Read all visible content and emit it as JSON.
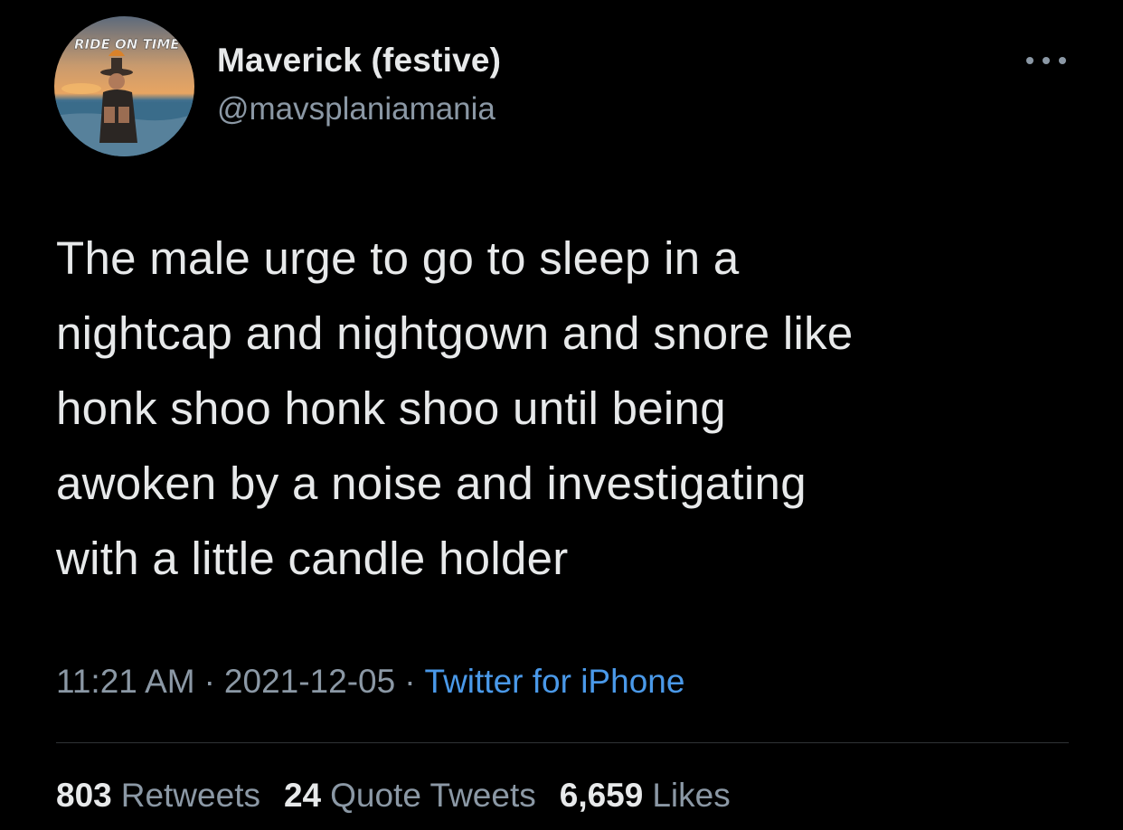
{
  "user": {
    "display_name": "Maverick (festive)",
    "handle": "@mavsplaniamania",
    "avatar_text": "RIDE ON TIME"
  },
  "tweet": {
    "text": "The male urge to go to sleep in a\nnightcap and nightgown and snore like\nhonk shoo honk shoo until being\nawoken by a noise and investigating\nwith a little candle holder",
    "time": "11:21 AM",
    "date": "2021-12-05",
    "separator": "·",
    "source": "Twitter for iPhone"
  },
  "stats": {
    "retweets": {
      "count": "803",
      "label": "Retweets"
    },
    "quote_tweets": {
      "count": "24",
      "label": "Quote Tweets"
    },
    "likes": {
      "count": "6,659",
      "label": "Likes"
    }
  },
  "icons": {
    "more": "more-options-icon"
  },
  "colors": {
    "background": "#000000",
    "primary_text": "#e7e9ea",
    "secondary_text": "#8b98a5",
    "link": "#4a99e9",
    "divider": "#2f3336"
  }
}
